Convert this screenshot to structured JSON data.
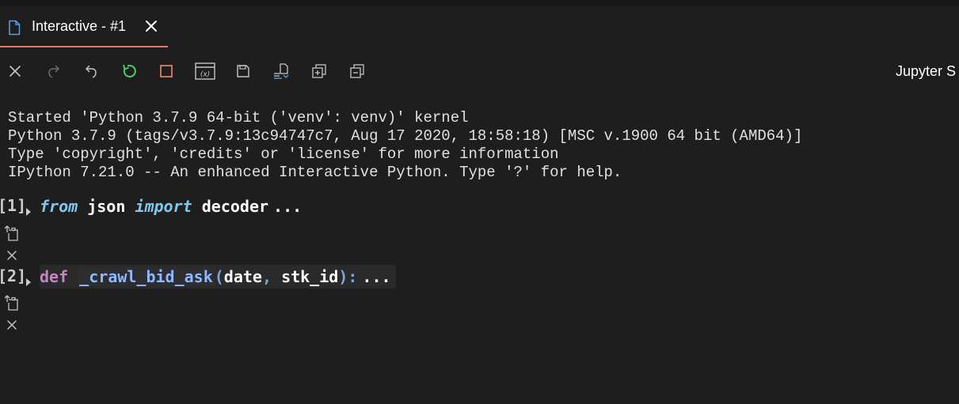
{
  "tab": {
    "title": "Interactive - #1",
    "icon": "file-icon",
    "close_icon": "close-icon"
  },
  "toolbar": {
    "buttons": [
      {
        "name": "clear-all-button",
        "icon": "close-icon"
      },
      {
        "name": "redo-button",
        "icon": "redo-icon"
      },
      {
        "name": "undo-button",
        "icon": "undo-icon"
      },
      {
        "name": "restart-kernel-button",
        "icon": "restart-icon"
      },
      {
        "name": "interrupt-kernel-button",
        "icon": "stop-icon"
      },
      {
        "name": "variables-button",
        "icon": "variables-icon"
      },
      {
        "name": "save-button",
        "icon": "save-icon"
      },
      {
        "name": "export-button",
        "icon": "export-icon"
      },
      {
        "name": "expand-all-button",
        "icon": "expand-all-icon"
      },
      {
        "name": "collapse-all-button",
        "icon": "collapse-all-icon"
      }
    ],
    "right_label": "Jupyter S"
  },
  "output": {
    "lines": [
      "Started 'Python 3.7.9 64-bit ('venv': venv)' kernel",
      "Python 3.7.9 (tags/v3.7.9:13c94747c7, Aug 17 2020, 18:58:18) [MSC v.1900 64 bit (AMD64)]",
      "Type 'copyright', 'credits' or 'license' for more information",
      "IPython 7.21.0 -- An enhanced Interactive Python. Type '?' for help."
    ]
  },
  "cells": [
    {
      "number": "[1]",
      "tokens": {
        "kw1": "from",
        "mod": "json",
        "kw2": "import",
        "name": "decoder",
        "ellipsis": "..."
      }
    },
    {
      "number": "[2]",
      "tokens": {
        "kw": "def",
        "fn": "_crawl_bid_ask",
        "open": "(",
        "arg1": "date",
        "comma": ",",
        "arg2": "stk_id",
        "close": "):",
        "ellipsis": "..."
      }
    }
  ],
  "colors": {
    "background": "#1e1e1e",
    "tab_underline": "#e8776a",
    "restart_green": "#4ec969",
    "stop_orange": "#f48771",
    "keyword_italic": "#7ec8f0",
    "keyword_def": "#c586c0",
    "function_name": "#8fb8ff"
  }
}
